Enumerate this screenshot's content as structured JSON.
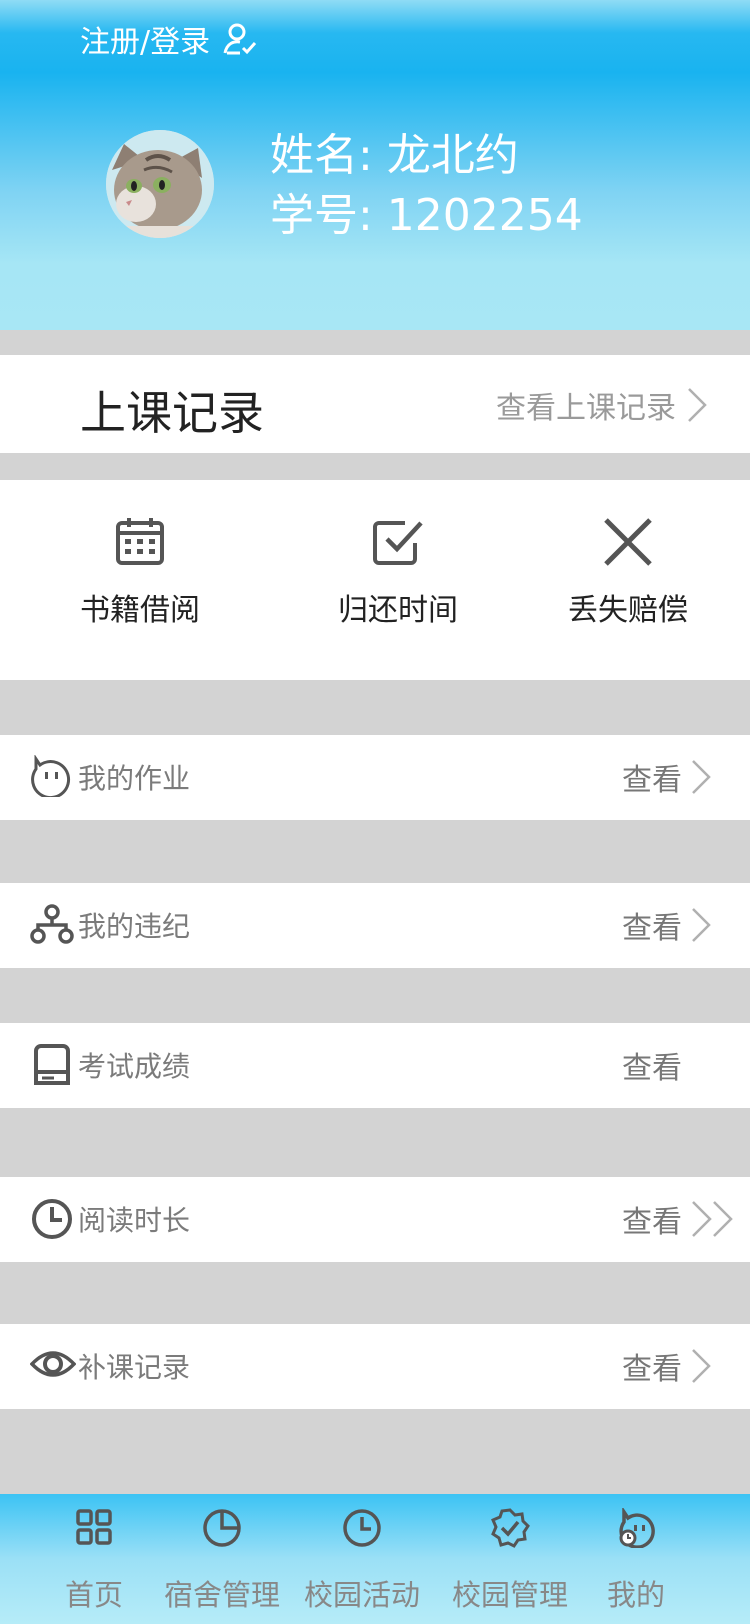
{
  "header": {
    "login_label": "注册/登录",
    "name_line": "姓名: 龙北约",
    "id_line": "学号: 1202254"
  },
  "class_record": {
    "title": "上课记录",
    "link": "查看上课记录"
  },
  "actions": [
    {
      "label": "书籍借阅",
      "icon": "calendar-icon"
    },
    {
      "label": "归还时间",
      "icon": "checkbox-icon"
    },
    {
      "label": "丢失赔偿",
      "icon": "close-icon"
    }
  ],
  "rows": [
    {
      "label": "我的作业",
      "link": "查看",
      "icon": "chat-face-icon"
    },
    {
      "label": "我的违纪",
      "link": "查看",
      "icon": "network-icon"
    },
    {
      "label": "考试成绩",
      "link": "查看",
      "icon": "drive-icon"
    },
    {
      "label": "阅读时长",
      "link": "查看",
      "icon": "clock-icon"
    },
    {
      "label": "补课记录",
      "link": "查看",
      "icon": "eye-icon"
    }
  ],
  "tabs": [
    {
      "label": "首页",
      "icon": "grid-icon"
    },
    {
      "label": "宿舍管理",
      "icon": "pie-icon"
    },
    {
      "label": "校园活动",
      "icon": "clock-icon"
    },
    {
      "label": "校园管理",
      "icon": "badge-check-icon"
    },
    {
      "label": "我的",
      "icon": "user-face-icon"
    }
  ],
  "colors": {
    "header_blue": "#19b3f0",
    "background_gray": "#d3d3d3",
    "icon_gray": "#555555"
  }
}
